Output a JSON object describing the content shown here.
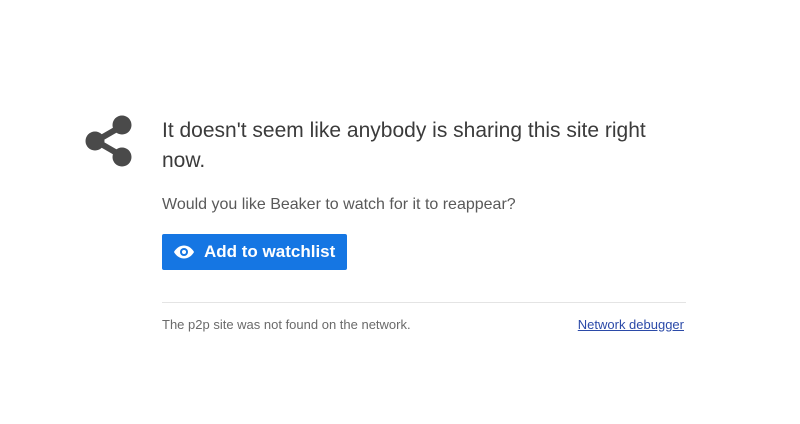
{
  "message": {
    "headline": "It doesn't seem like anybody is sharing this site right now.",
    "prompt": "Would you like Beaker to watch for it to reappear?"
  },
  "actions": {
    "watchlist_label": "Add to watchlist"
  },
  "footer": {
    "note": "The p2p site was not found on the network.",
    "debugger_link": "Network debugger"
  },
  "icons": {
    "main": "share-icon",
    "button": "eye-icon"
  },
  "colors": {
    "accent": "#1576e3",
    "icon": "#4a4a4a",
    "link": "#2b4aa8"
  }
}
